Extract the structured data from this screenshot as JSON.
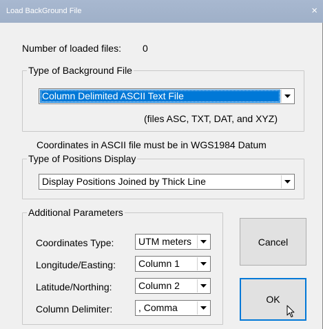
{
  "window": {
    "title": "Load BackGround File",
    "close_glyph": "×"
  },
  "loaded": {
    "label": "Number of loaded files:",
    "count": "0"
  },
  "type_group": {
    "legend": "Type of Background File",
    "selected": "Column Delimited ASCII Text File",
    "hint": "(files ASC, TXT, DAT, and XYZ)"
  },
  "datum_note": "Coordinates in ASCII file must be in WGS1984 Datum",
  "display_group": {
    "legend": "Type of Positions Display",
    "selected": "Display Positions Joined by Thick Line"
  },
  "params": {
    "legend": "Additional Parameters",
    "coord_type_label": "Coordinates Type:",
    "coord_type_value": "UTM meters",
    "lon_label": "Longitude/Easting:",
    "lon_value": "Column 1",
    "lat_label": "Latitude/Northing:",
    "lat_value": "Column 2",
    "delim_label": "Column Delimiter:",
    "delim_value": ", Comma"
  },
  "buttons": {
    "cancel": "Cancel",
    "ok": "OK"
  },
  "colors": {
    "titlebar": "#a8b8d0",
    "selection": "#0078d7",
    "dialog_bg": "#f0f0f0"
  },
  "icons": [
    "close-icon",
    "chevron-down-icon",
    "mouse-pointer-icon"
  ]
}
